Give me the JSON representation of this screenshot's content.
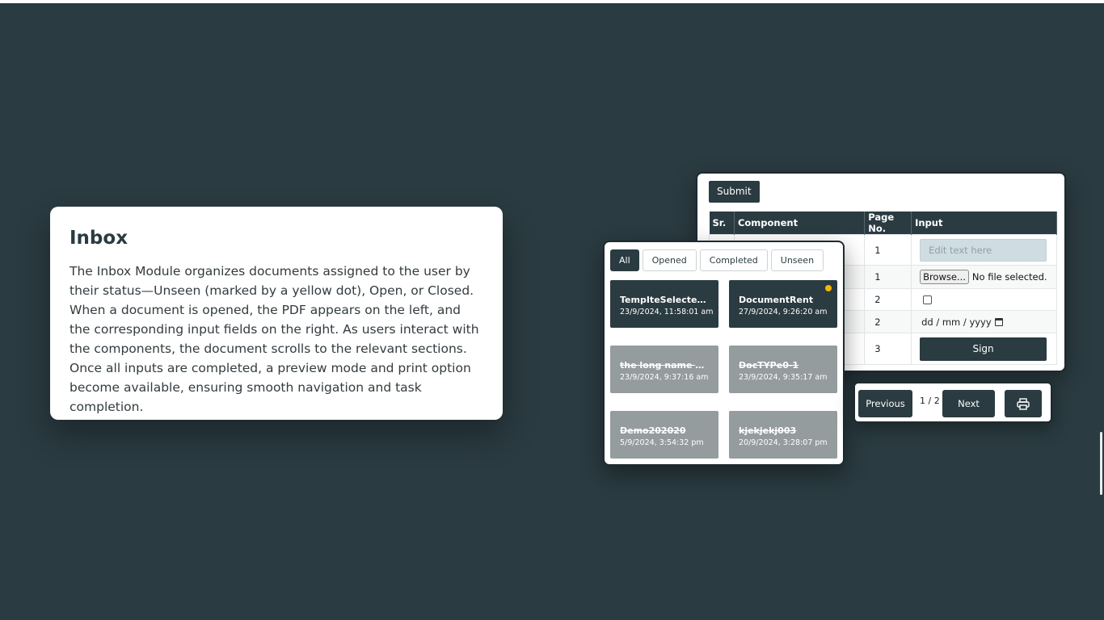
{
  "info": {
    "title": "Inbox",
    "body": "The Inbox Module organizes documents assigned to the user by their status—Unseen (marked by a yellow dot), Open, or Closed. When a document is opened, the PDF appears on the left, and the corresponding input fields on the right. As users interact with the components, the document scrolls to the relevant sections. Once all inputs are completed, a preview mode and print option become available, ensuring smooth navigation and task completion."
  },
  "form": {
    "submit_label": "Submit",
    "headers": {
      "sr": "Sr.",
      "component": "Component",
      "page": "Page No.",
      "input": "Input"
    },
    "rows": [
      {
        "page": "1",
        "input_type": "text",
        "placeholder": "Edit text here"
      },
      {
        "page": "1",
        "input_type": "file",
        "browse_label": "Browse...",
        "file_status": "No file selected."
      },
      {
        "page": "2",
        "input_type": "checkbox"
      },
      {
        "page": "2",
        "input_type": "date",
        "date_placeholder": "dd / mm / yyyy"
      },
      {
        "page": "3",
        "input_type": "button",
        "button_label": "Sign"
      }
    ]
  },
  "inbox": {
    "filters": [
      "All",
      "Opened",
      "Completed",
      "Unseen"
    ],
    "active_filter": "All",
    "documents": [
      {
        "name": "TempIteSelected Doc",
        "date": "23/9/2024, 11:58:01 am",
        "status": "open",
        "unseen": false
      },
      {
        "name": "DocumentRent",
        "date": "27/9/2024, 9:26:20 am",
        "status": "open",
        "unseen": true
      },
      {
        "name": "the long name with some extra text",
        "date": "23/9/2024, 9:37:16 am",
        "status": "closed",
        "unseen": false
      },
      {
        "name": "DocTYPe0-1",
        "date": "23/9/2024, 9:35:17 am",
        "status": "closed",
        "unseen": false
      },
      {
        "name": "Demo202020",
        "date": "5/9/2024, 3:54:32 pm",
        "status": "closed",
        "unseen": false
      },
      {
        "name": "kjekjekj003",
        "date": "20/9/2024, 3:28:07 pm",
        "status": "closed",
        "unseen": false
      }
    ]
  },
  "pager": {
    "previous_label": "Previous",
    "page_indicator": "1 / 2",
    "next_label": "Next",
    "print_icon": "printer-icon"
  },
  "colors": {
    "background": "#2a3b41",
    "primary": "#2a3b41",
    "closed_card": "#949c9e",
    "unseen_dot": "#f2b705",
    "input_fill": "#cfdde2"
  }
}
